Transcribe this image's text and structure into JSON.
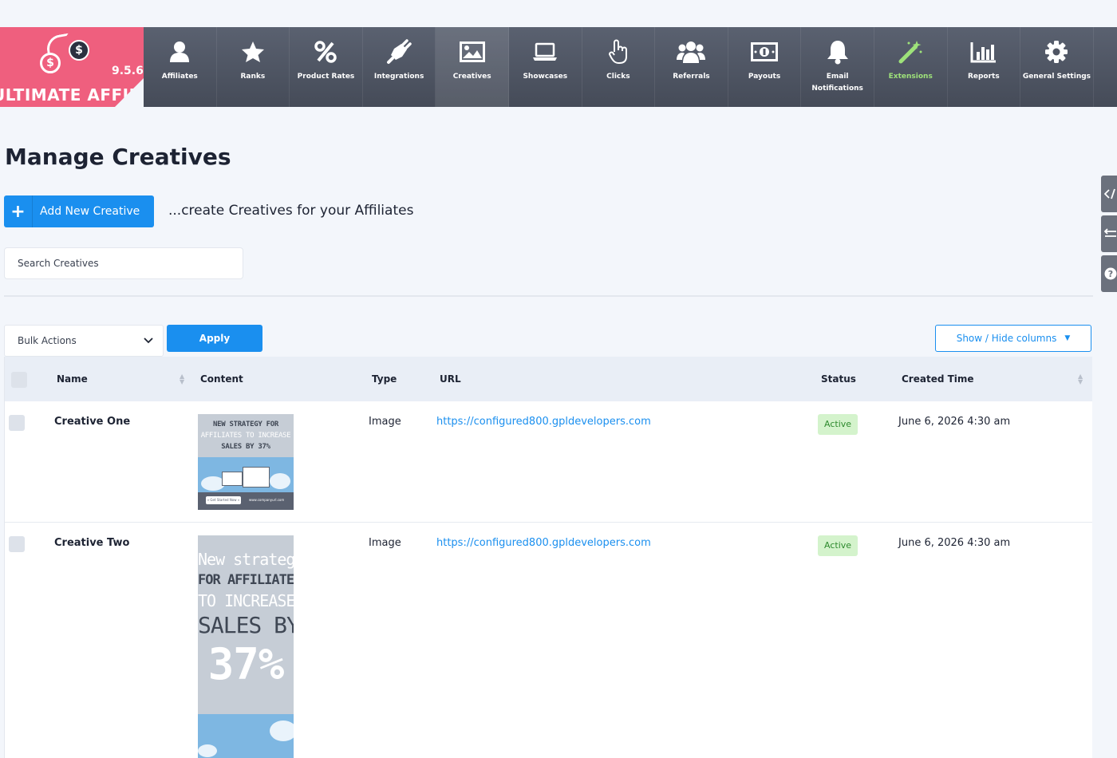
{
  "app": {
    "version": "9.5.6",
    "brand": "ULTIMATE AFFILIATE"
  },
  "nav": {
    "items": [
      {
        "label": "Affiliates",
        "icon": "user-icon"
      },
      {
        "label": "Ranks",
        "icon": "star-icon"
      },
      {
        "label": "Product Rates",
        "icon": "percent-icon"
      },
      {
        "label": "Integrations",
        "icon": "plug-icon"
      },
      {
        "label": "Creatives",
        "icon": "image-icon",
        "active": true
      },
      {
        "label": "Showcases",
        "icon": "laptop-icon"
      },
      {
        "label": "Clicks",
        "icon": "pointer-hand-icon"
      },
      {
        "label": "Referrals",
        "icon": "users-icon"
      },
      {
        "label": "Payouts",
        "icon": "money-bill-icon"
      },
      {
        "label": "Email Notifications",
        "icon": "bell-icon"
      },
      {
        "label": "Extensions",
        "icon": "magic-wand-icon",
        "highlight_color": "#9ee27a"
      },
      {
        "label": "Reports",
        "icon": "bar-chart-icon"
      },
      {
        "label": "General Settings",
        "icon": "gear-icon"
      }
    ]
  },
  "page": {
    "title": "Manage Creatives",
    "add_button": "Add New Creative",
    "add_icon": "+",
    "subtitle": "...create Creatives for your Affiliates",
    "search_placeholder": "Search Creatives"
  },
  "toolbar": {
    "bulk_actions": "Bulk Actions",
    "apply": "Apply",
    "show_hide": "Show / Hide columns"
  },
  "table": {
    "columns": {
      "name": "Name",
      "content": "Content",
      "type": "Type",
      "url": "URL",
      "status": "Status",
      "created": "Created Time"
    },
    "rows": [
      {
        "name": "Creative One",
        "type": "Image",
        "url": "https://configured800.gpldevelopers.com",
        "status": "Active",
        "created": "June 6, 2026 4:30 am",
        "thumb": {
          "line1": "NEW STRATEGY FOR",
          "line2": "AFFILIATES TO INCREASE",
          "line3": "SALES BY 37%",
          "cta": "» Get Started Now »",
          "site": "www.companyurl.com"
        }
      },
      {
        "name": "Creative Two",
        "type": "Image",
        "url": "https://configured800.gpldevelopers.com",
        "status": "Active",
        "created": "June 6, 2026 4:30 am",
        "thumb": {
          "line1": "New strategy",
          "line2": "FOR AFFILIATES",
          "line3": "TO INCREASE",
          "line4": "SALES BY",
          "line5": "37%"
        }
      }
    ]
  },
  "colors": {
    "accent": "#1a8fef",
    "brand": "#ef5f7e",
    "nav_bg": "#4f5563",
    "status_active_bg": "#d4f3cc"
  }
}
